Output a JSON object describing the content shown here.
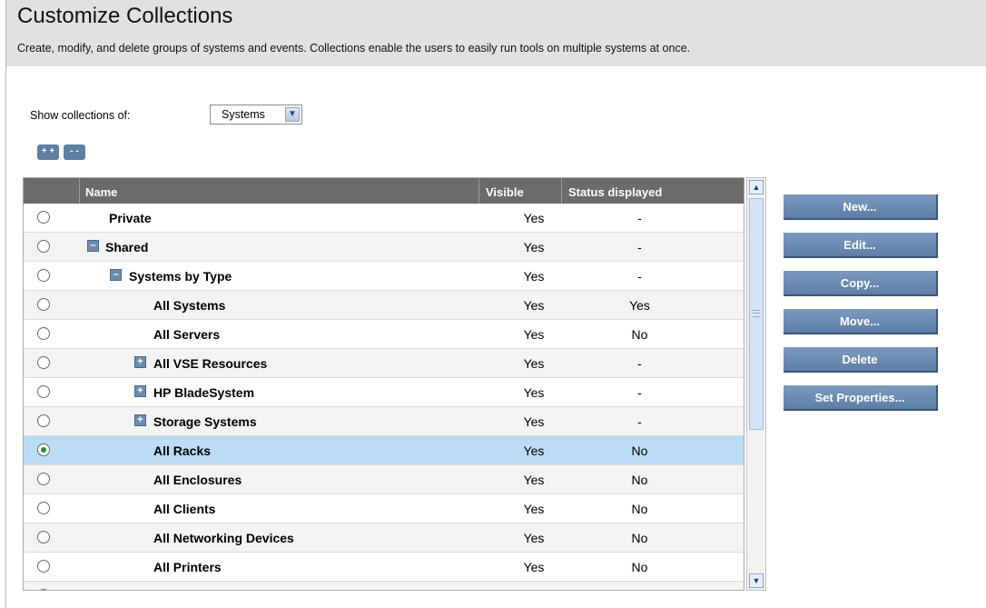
{
  "page": {
    "title": "Customize Collections",
    "subtitle": "Create, modify, and delete groups of systems and events. Collections enable the users to easily run tools on multiple systems at once."
  },
  "filter": {
    "label": "Show collections of:",
    "selected": "Systems"
  },
  "expand_all_label": "+ +",
  "collapse_all_label": "- -",
  "table": {
    "columns": [
      "Name",
      "Visible",
      "Status displayed"
    ],
    "rows": [
      {
        "name": "Private",
        "visible": "Yes",
        "status": "-"
      },
      {
        "name": "Shared",
        "visible": "Yes",
        "status": "-"
      },
      {
        "name": "Systems by Type",
        "visible": "Yes",
        "status": "-"
      },
      {
        "name": "All Systems",
        "visible": "Yes",
        "status": "Yes"
      },
      {
        "name": "All Servers",
        "visible": "Yes",
        "status": "No"
      },
      {
        "name": "All VSE Resources",
        "visible": "Yes",
        "status": "-"
      },
      {
        "name": "HP BladeSystem",
        "visible": "Yes",
        "status": "-"
      },
      {
        "name": "Storage Systems",
        "visible": "Yes",
        "status": "-"
      },
      {
        "name": "All Racks",
        "visible": "Yes",
        "status": "No"
      },
      {
        "name": "All Enclosures",
        "visible": "Yes",
        "status": "No"
      },
      {
        "name": "All Clients",
        "visible": "Yes",
        "status": "No"
      },
      {
        "name": "All Networking Devices",
        "visible": "Yes",
        "status": "No"
      },
      {
        "name": "All Printers",
        "visible": "Yes",
        "status": "No"
      }
    ]
  },
  "actions": {
    "new": "New...",
    "edit": "Edit...",
    "copy": "Copy...",
    "move": "Move...",
    "delete": "Delete",
    "set_properties": "Set Properties..."
  }
}
